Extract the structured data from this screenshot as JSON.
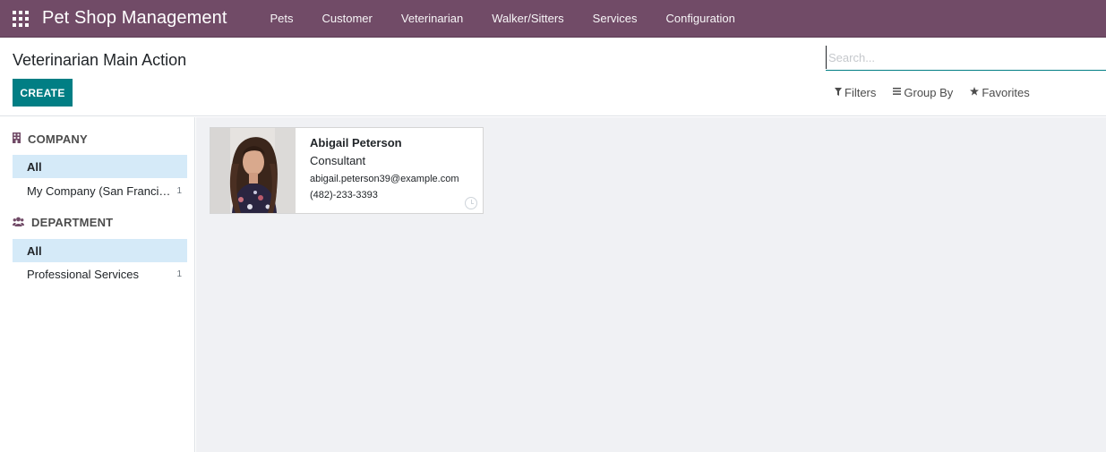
{
  "navbar": {
    "app_title": "Pet Shop Management",
    "menu": [
      "Pets",
      "Customer",
      "Veterinarian",
      "Walker/Sitters",
      "Services",
      "Configuration"
    ],
    "color": "#714b67"
  },
  "control_panel": {
    "title": "Veterinarian Main Action",
    "create_label": "CREATE",
    "search_placeholder": "Search...",
    "filters_label": "Filters",
    "group_by_label": "Group By",
    "favorites_label": "Favorites",
    "accent": "#017e84"
  },
  "sidebar": {
    "company": {
      "heading": "COMPANY",
      "icon": "building-icon",
      "items": [
        {
          "label": "All",
          "active": true
        },
        {
          "label": "My Company (San Francisco)",
          "count": "1"
        }
      ]
    },
    "department": {
      "heading": "DEPARTMENT",
      "icon": "users-icon",
      "items": [
        {
          "label": "All",
          "active": true
        },
        {
          "label": "Professional Services",
          "count": "1"
        }
      ]
    }
  },
  "cards": [
    {
      "name": "Abigail Peterson",
      "job": "Consultant",
      "email": "abigail.peterson39@example.com",
      "phone": "(482)-233-3393",
      "status_icon": "clock-icon"
    }
  ]
}
